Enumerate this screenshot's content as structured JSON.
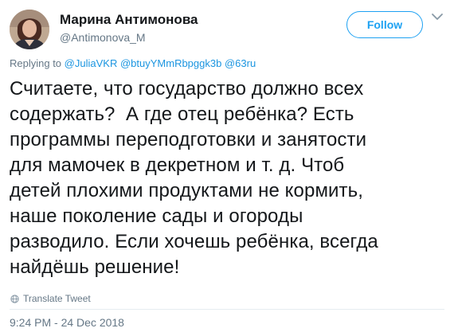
{
  "author": {
    "display_name": "Марина Антимонова",
    "handle": "@Antimonova_M",
    "avatar_icon": "profile-photo-avatar"
  },
  "follow_button": {
    "label": "Follow",
    "color": "#1da1f2"
  },
  "more_menu": {
    "icon": "chevron-down-icon"
  },
  "reply": {
    "prefix": "Replying to",
    "mentions": [
      "@JuliaVKR",
      "@btuyYMmRbpggk3b",
      "@63ru"
    ],
    "mention_color": "#1b95e0"
  },
  "tweet": {
    "line1": "Считаете, что государство должно всех",
    "line2": "содержать?  А где отец ребёнка? Есть",
    "line3": "программы переподготовки и занятости",
    "line4": "для мамочек в декретном и т. д. Чтоб",
    "line5": "детей плохими продуктами не кормить,",
    "line6": "наше поколение сады и огороды",
    "line7": "разводило. Если хочешь ребёнка, всегда",
    "line8": "найдёшь решение!"
  },
  "translate": {
    "label": "Translate Tweet",
    "icon": "globe-icon"
  },
  "timestamp": "9:24 PM - 24 Dec 2018"
}
